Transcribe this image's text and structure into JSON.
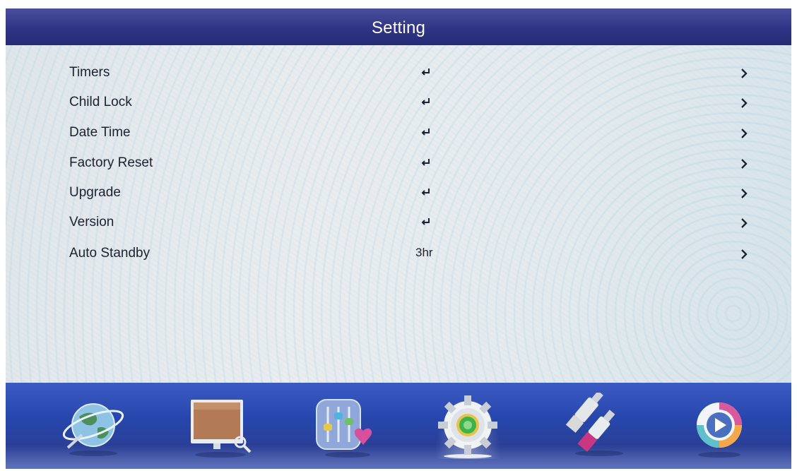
{
  "header": {
    "title": "Setting"
  },
  "menu": {
    "items": [
      {
        "label": "Timers",
        "value": "",
        "value_icon": "enter-icon",
        "arrow_icon": "chevron-right-icon"
      },
      {
        "label": "Child Lock",
        "value": "",
        "value_icon": "enter-icon",
        "arrow_icon": "chevron-right-icon"
      },
      {
        "label": "Date Time",
        "value": "",
        "value_icon": "enter-icon",
        "arrow_icon": "chevron-right-icon"
      },
      {
        "label": "Factory Reset",
        "value": "",
        "value_icon": "enter-icon",
        "arrow_icon": "chevron-right-icon"
      },
      {
        "label": "Upgrade",
        "value": "",
        "value_icon": "enter-icon",
        "arrow_icon": "chevron-right-icon"
      },
      {
        "label": "Version",
        "value": "",
        "value_icon": "enter-icon",
        "arrow_icon": "chevron-right-icon"
      },
      {
        "label": "Auto Standby",
        "value": "3hr",
        "value_icon": "",
        "arrow_icon": "chevron-right-icon"
      }
    ]
  },
  "bottom_nav": {
    "items": [
      {
        "icon": "globe-icon",
        "active": false
      },
      {
        "icon": "monitor-icon",
        "active": false
      },
      {
        "icon": "equalizer-icon",
        "active": false
      },
      {
        "icon": "gear-icon",
        "active": true
      },
      {
        "icon": "av-cable-icon",
        "active": false
      },
      {
        "icon": "play-icon",
        "active": false
      }
    ]
  },
  "colors": {
    "title_bar": "#2f3584",
    "bottom_bar": "#2747ae",
    "text": "#1e2230"
  }
}
